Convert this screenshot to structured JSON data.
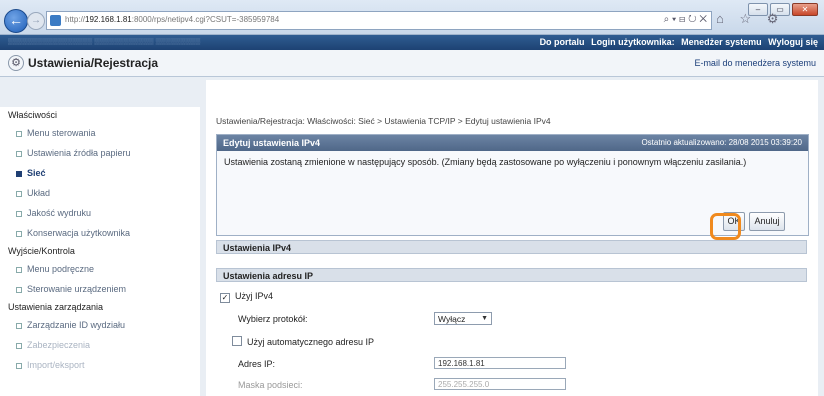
{
  "browser": {
    "url_host": "192.168.1.81",
    "url_rest": ":8000/rps/netipv4.cgi?CSUT=-385959784",
    "url_prefix": "http://",
    "address_tools": "⌕ ▾ ⊟ ↻ ✕",
    "favs_icons": "⌂ ☆ ⚙",
    "win_min": "–",
    "win_max": "▭",
    "win_close": "✕"
  },
  "topbar": {
    "portal": "Do portalu",
    "login_label": "Login użytkownika:",
    "login_value": "Menedżer systemu",
    "logout": "Wyloguj się"
  },
  "header": {
    "title": "Ustawienia/Rejestracja",
    "mail_link": "E-mail do menedżera systemu"
  },
  "sidebar": {
    "sections": [
      {
        "label": "Właściwości",
        "items": [
          {
            "label": "Menu sterowania"
          },
          {
            "label": "Ustawienia źródła papieru"
          },
          {
            "label": "Sieć"
          },
          {
            "label": "Układ"
          },
          {
            "label": "Jakość wydruku"
          },
          {
            "label": "Konserwacja użytkownika"
          }
        ]
      },
      {
        "label": "Wyjście/Kontrola",
        "items": [
          {
            "label": "Menu podręczne"
          },
          {
            "label": "Sterowanie urządzeniem"
          }
        ]
      },
      {
        "label": "Ustawienia zarządzania",
        "items": [
          {
            "label": "Zarządzanie ID wydziału"
          },
          {
            "label": "Zabezpieczenia"
          },
          {
            "label": "Import/eksport"
          }
        ]
      }
    ]
  },
  "main": {
    "breadcrumb": "Ustawienia/Rejestracja: Właściwości: Sieć > Ustawienia TCP/IP > Edytuj ustawienia IPv4",
    "panel": {
      "title": "Edytuj ustawienia IPv4",
      "updated": "Ostatnio aktualizowano: 28/08 2015 03:39:20",
      "message": "Ustawienia zostaną zmienione w następujący sposób. (Zmiany będą zastosowane po wyłączeniu i ponownym włączeniu zasilania.)",
      "ok_label": "OK",
      "cancel_label": "Anuluj"
    },
    "section_ipv4": "Ustawienia IPv4",
    "section_ip": "Ustawienia adresu IP",
    "use_ipv4_label": "Użyj IPv4",
    "protocol_label": "Wybierz protokół:",
    "protocol_value": "Wyłącz",
    "auto_ip_label": "Użyj automatycznego adresu IP",
    "ip_label": "Adres IP:",
    "ip_value": "192.168.1.81",
    "mask_label": "Maska podsieci:",
    "mask_value": "255.255.255.0"
  }
}
